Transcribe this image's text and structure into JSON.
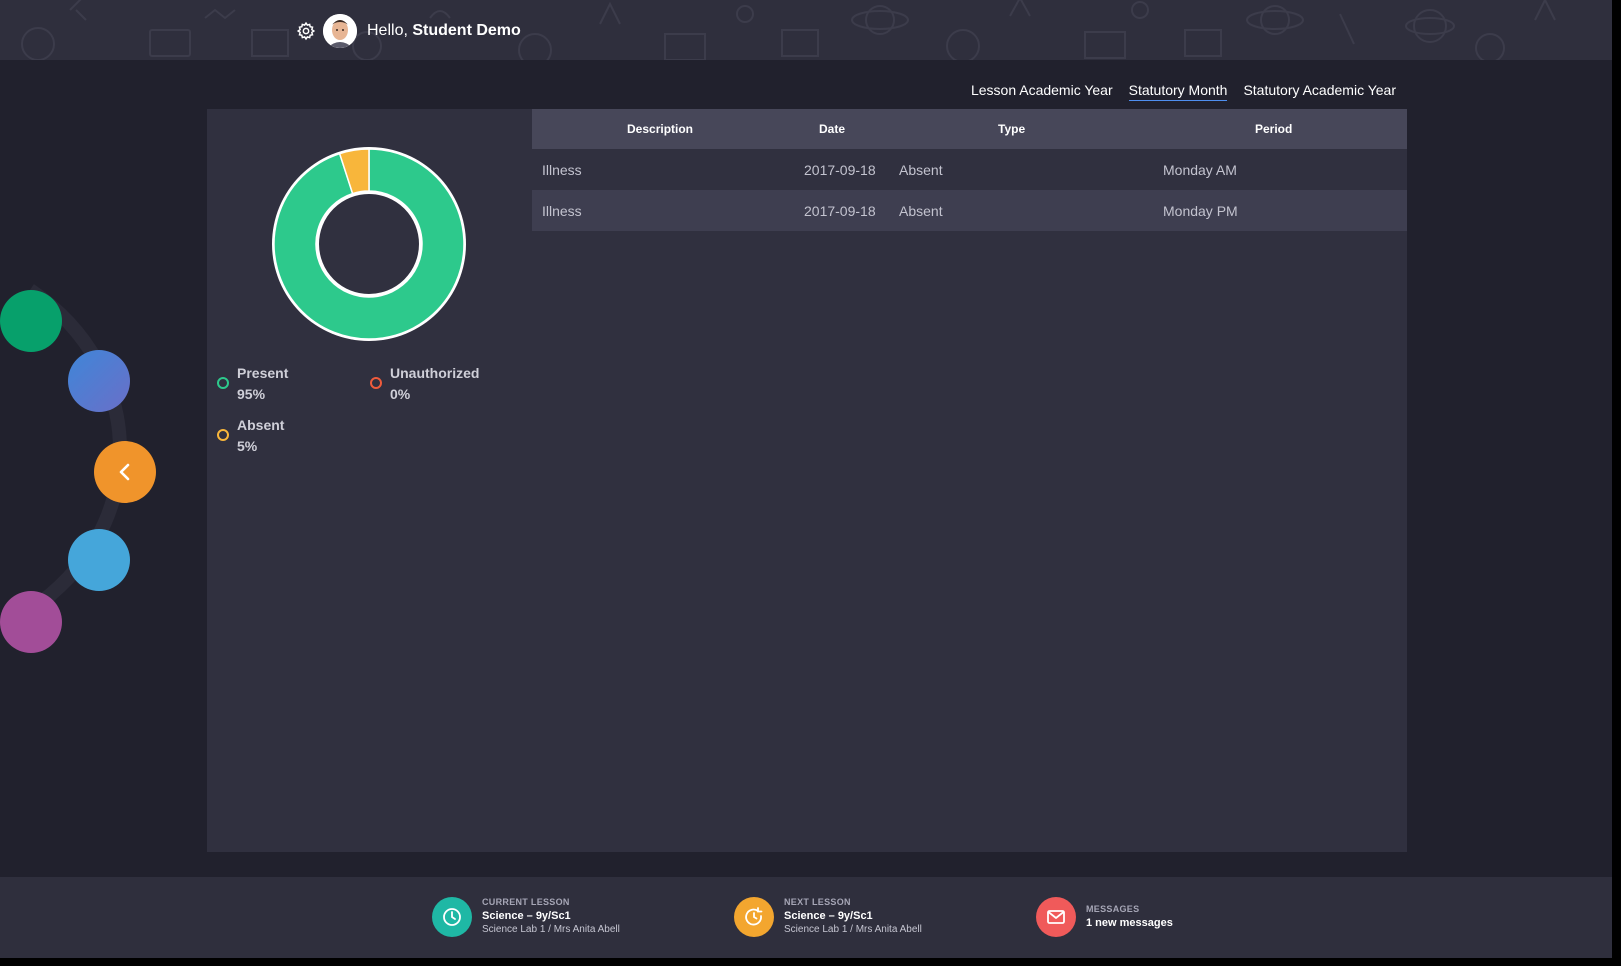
{
  "header": {
    "greeting_prefix": "Hello, ",
    "user_name": "Student Demo"
  },
  "filter_tabs": [
    {
      "label": "Lesson Academic Year",
      "active": false
    },
    {
      "label": "Statutory Month",
      "active": true
    },
    {
      "label": "Statutory Academic Year",
      "active": false
    }
  ],
  "attendance": {
    "legend": [
      {
        "label": "Present",
        "value": "95%",
        "color": "#2dc98c"
      },
      {
        "label": "Unauthorized",
        "value": "0%",
        "color": "#ef5b3c"
      },
      {
        "label": "Absent",
        "value": "5%",
        "color": "#f8b63b"
      }
    ]
  },
  "chart_data": {
    "type": "pie",
    "categories": [
      "Present",
      "Unauthorized",
      "Absent"
    ],
    "values": [
      95,
      0,
      5
    ],
    "colors": [
      "#2dc98c",
      "#ef5b3c",
      "#f8b63b"
    ]
  },
  "table": {
    "headers": [
      "Description",
      "Date",
      "Type",
      "Period"
    ],
    "rows": [
      {
        "description": "Illness",
        "date": "2017-09-18",
        "type": "Absent",
        "period": "Monday AM"
      },
      {
        "description": "Illness",
        "date": "2017-09-18",
        "type": "Absent",
        "period": "Monday PM"
      }
    ]
  },
  "footer": {
    "current_lesson": {
      "label": "CURRENT LESSON",
      "title": "Science – 9y/Sc1",
      "subtitle": "Science Lab 1 / Mrs Anita Abell",
      "color": "#1fb8a5",
      "icon": "clock-icon"
    },
    "next_lesson": {
      "label": "NEXT LESSON",
      "title": "Science – 9y/Sc1",
      "subtitle": "Science Lab 1 / Mrs Anita Abell",
      "color": "#f3a62f",
      "icon": "clock-refresh-icon"
    },
    "messages": {
      "label": "MESSAGES",
      "title": "1 new messages",
      "color": "#f05a5a",
      "icon": "envelope-icon"
    }
  },
  "side_nav": {
    "colors": [
      "#07a06b",
      "#4e7ed4",
      "#f0942b",
      "#45a6da",
      "#a24d98"
    ],
    "center_icon": "chevron-left-icon"
  }
}
